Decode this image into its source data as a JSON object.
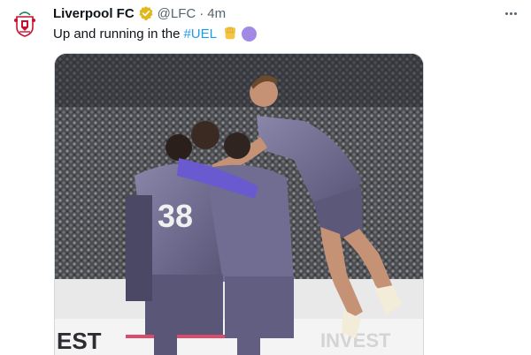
{
  "tweet": {
    "display_name": "Liverpool FC",
    "handle": "@LFC",
    "separator": "·",
    "time": "4m",
    "text": "Up and running in the",
    "hashtag": "#UEL",
    "emojis": [
      "raised-fist-emoji",
      "purple-circle-emoji"
    ]
  },
  "icons": {
    "avatar": "liverpool-crest",
    "verified": "verified-badge-icon",
    "more": "more-options-icon"
  },
  "media": {
    "banner_left": "EST",
    "banner_right": "INVEST",
    "shirt_number": "38"
  },
  "colors": {
    "verified_gold": "#e2b719",
    "hashtag_blue": "#1d9bf0",
    "kit_purple": "#6e6a8e",
    "crest_red": "#c8102e"
  }
}
